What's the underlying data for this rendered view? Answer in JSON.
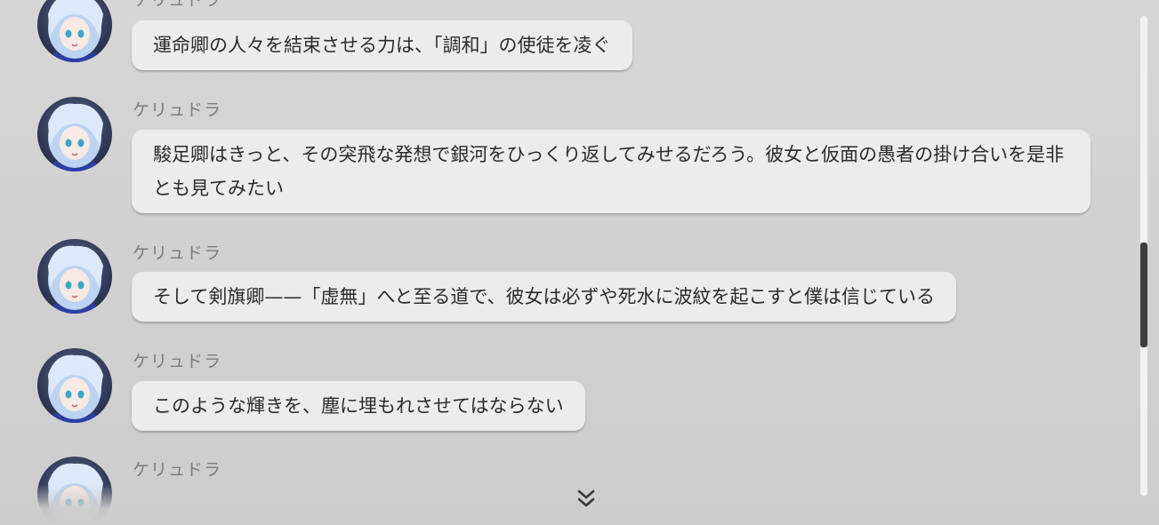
{
  "messages": [
    {
      "sender": "ケリュドラ",
      "text": "運命卿の人々を結束させる力は、「調和」の使徒を凌ぐ"
    },
    {
      "sender": "ケリュドラ",
      "text": "駿足卿はきっと、その突飛な発想で銀河をひっくり返してみせるだろう。彼女と仮面の愚者の掛け合いを是非とも見てみたい"
    },
    {
      "sender": "ケリュドラ",
      "text": "そして剣旗卿——「虚無」へと至る道で、彼女は必ずや死水に波紋を起こすと僕は信じている"
    },
    {
      "sender": "ケリュドラ",
      "text": "このような輝きを、塵に埋もれさせてはならない"
    },
    {
      "sender": "ケリュドラ",
      "text": ""
    }
  ],
  "icons": {
    "avatar": "character-avatar",
    "scroll_down": "double-chevron-down-icon"
  },
  "colors": {
    "bubble": "#ececec",
    "sender_text": "#7b7b7b",
    "message_text": "#2b2b2b",
    "scrollbar_thumb": "#3d3d3d"
  }
}
